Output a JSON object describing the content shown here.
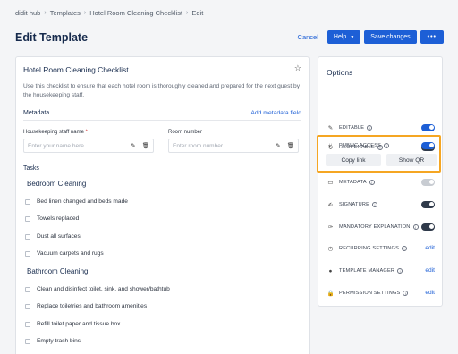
{
  "breadcrumb": [
    "didit hub",
    "Templates",
    "Hotel Room Cleaning Checklist",
    "Edit"
  ],
  "page_title": "Edit Template",
  "header_actions": {
    "cancel": "Cancel",
    "help": "Help",
    "save": "Save changes",
    "more": "•••"
  },
  "checklist": {
    "title": "Hotel Room Cleaning Checklist",
    "description": "Use this checklist to ensure that each hotel room is thoroughly cleaned and prepared for the next guest by the housekeeping staff.",
    "metadata_label": "Metadata",
    "add_metadata": "Add metadata field",
    "fields": [
      {
        "label": "Housekeeping staff name",
        "required": "*",
        "placeholder": "Enter your name here ..."
      },
      {
        "label": "Room number",
        "required": "",
        "placeholder": "Enter room number ..."
      }
    ],
    "tasks_label": "Tasks",
    "groups": [
      {
        "title": "Bedroom Cleaning",
        "tasks": [
          "Bed linen changed and beds made",
          "Towels replaced",
          "Dust all surfaces",
          "Vacuum carpets and rugs"
        ]
      },
      {
        "title": "Bathroom Cleaning",
        "tasks": [
          "Clean and disinfect toilet, sink, and shower/bathtub",
          "Replace toiletries and bathroom amenities",
          "Refill toilet paper and tissue box",
          "Empty trash bins"
        ]
      }
    ]
  },
  "options": {
    "title": "Options",
    "rows": [
      {
        "label": "EDITABLE",
        "icon": "pencil-icon",
        "control": "toggle-on"
      },
      {
        "label": "REOPENABLE",
        "icon": "reopen-icon",
        "control": "toggle-dark"
      },
      {
        "label": "PUBLIC ACCESS",
        "icon": "public-access-icon",
        "control": "toggle-on"
      },
      {
        "label": "METADATA",
        "icon": "metadata-icon",
        "control": "toggle-disabled"
      },
      {
        "label": "SIGNATURE",
        "icon": "signature-icon",
        "control": "toggle-dark"
      },
      {
        "label": "MANDATORY EXPLANATION",
        "icon": "explanation-icon",
        "control": "toggle-dark"
      },
      {
        "label": "RECURRING SETTINGS",
        "icon": "recurring-icon",
        "control": "edit"
      },
      {
        "label": "TEMPLATE MANAGER",
        "icon": "manager-icon",
        "control": "edit"
      },
      {
        "label": "PERMISSION SETTINGS",
        "icon": "lock-icon",
        "control": "edit"
      }
    ],
    "copy_link": "Copy link",
    "show_qr": "Show QR",
    "edit_label": "edit"
  },
  "colors": {
    "accent": "#1d5fd6",
    "highlight": "#f5a623",
    "toggle_dark": "#2f3a4a"
  }
}
